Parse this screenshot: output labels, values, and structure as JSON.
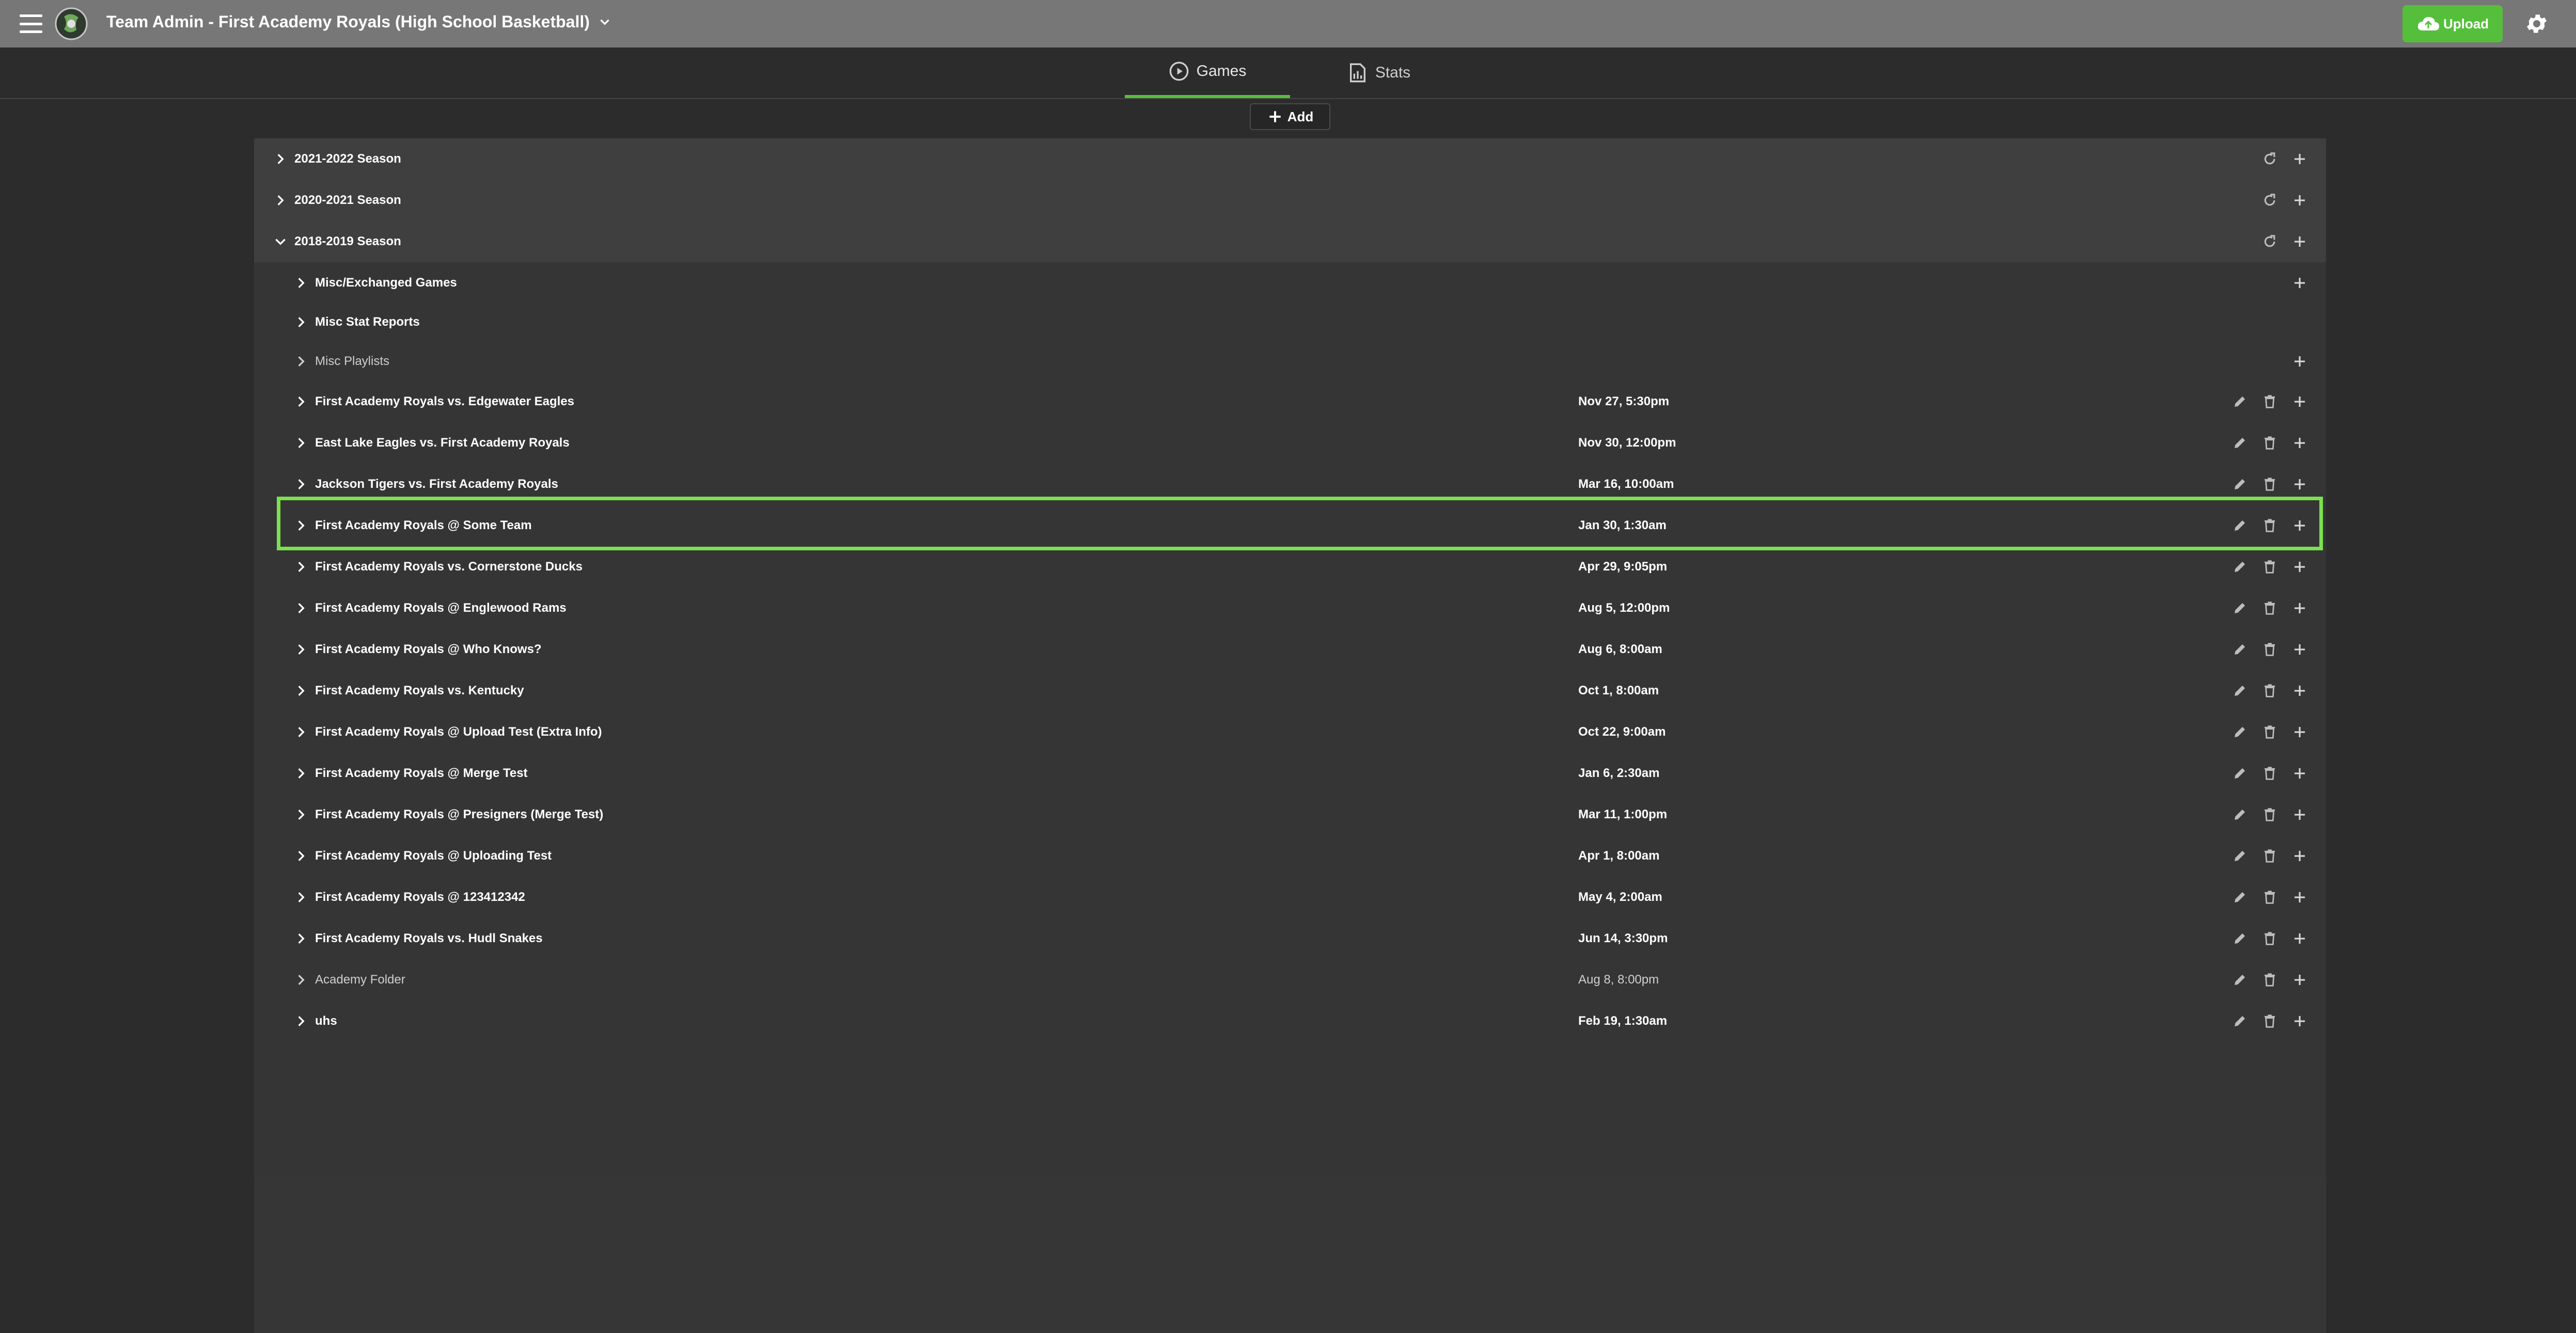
{
  "header": {
    "title": "Team Admin - First Academy Royals (High School Basketball)",
    "upload_label": "Upload"
  },
  "tabs": [
    {
      "label": "Games",
      "icon": "play-circle-icon",
      "active": true
    },
    {
      "label": "Stats",
      "icon": "stats-report-icon",
      "active": false
    }
  ],
  "toolbar": {
    "add_label": "Add"
  },
  "seasons": [
    {
      "label": "2021-2022 Season",
      "expanded": false
    },
    {
      "label": "2020-2021 Season",
      "expanded": false
    },
    {
      "label": "2018-2019 Season",
      "expanded": true
    }
  ],
  "folders": [
    {
      "label": "Misc/Exchanged Games",
      "bold": true
    },
    {
      "label": "Misc Stat Reports",
      "bold": true
    },
    {
      "label": "Misc Playlists",
      "bold": false
    }
  ],
  "games": [
    {
      "label": "First Academy Royals vs. Edgewater Eagles",
      "date": "Nov 27, 5:30pm",
      "bold": true
    },
    {
      "label": "East Lake Eagles vs. First Academy Royals",
      "date": "Nov 30, 12:00pm",
      "bold": true
    },
    {
      "label": "Jackson Tigers vs. First Academy Royals",
      "date": "Mar 16, 10:00am",
      "bold": true
    },
    {
      "label": "First Academy Royals @ Some Team",
      "date": "Jan 30, 1:30am",
      "bold": true,
      "selected": true
    },
    {
      "label": "First Academy Royals vs. Cornerstone Ducks",
      "date": "Apr 29, 9:05pm",
      "bold": true
    },
    {
      "label": "First Academy Royals @ Englewood Rams",
      "date": "Aug 5, 12:00pm",
      "bold": true
    },
    {
      "label": "First Academy Royals @ Who Knows?",
      "date": "Aug 6, 8:00am",
      "bold": true
    },
    {
      "label": "First Academy Royals vs. Kentucky",
      "date": "Oct 1, 8:00am",
      "bold": true
    },
    {
      "label": "First Academy Royals @ Upload Test (Extra Info)",
      "date": "Oct 22, 9:00am",
      "bold": true
    },
    {
      "label": "First Academy Royals @ Merge Test",
      "date": "Jan 6, 2:30am",
      "bold": true
    },
    {
      "label": "First Academy Royals @ Presigners (Merge Test)",
      "date": "Mar 11, 1:00pm",
      "bold": true
    },
    {
      "label": "First Academy Royals @ Uploading Test",
      "date": "Apr 1, 8:00am",
      "bold": true
    },
    {
      "label": "First Academy Royals @ 123412342",
      "date": "May 4, 2:00am",
      "bold": true
    },
    {
      "label": "First Academy Royals vs. Hudl Snakes",
      "date": "Jun 14, 3:30pm",
      "bold": true
    },
    {
      "label": "Academy Folder",
      "date": "Aug 8, 8:00pm",
      "bold": false
    },
    {
      "label": "uhs",
      "date": "Feb 19, 1:30am",
      "bold": true
    }
  ],
  "colors": {
    "accent": "#55bf3c",
    "highlight": "#7be14e",
    "header_bg": "#777777",
    "page_bg": "#2c2c2c"
  }
}
